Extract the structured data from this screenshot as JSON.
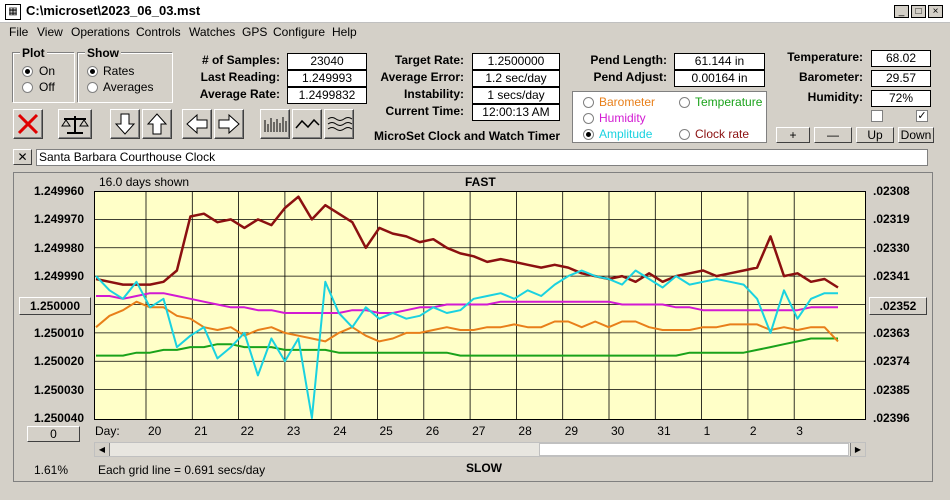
{
  "window": {
    "title": "C:\\microset\\2023_06_03.mst"
  },
  "menu": [
    "File",
    "View",
    "Operations",
    "Controls",
    "Watches",
    "GPS",
    "Configure",
    "Help"
  ],
  "plot_group": {
    "title": "Plot",
    "options": [
      "On",
      "Off"
    ],
    "selected": "On"
  },
  "show_group": {
    "title": "Show",
    "options": [
      "Rates",
      "Averages"
    ],
    "selected": "Rates"
  },
  "stats": {
    "samples_label": "# of Samples:",
    "samples": "23040",
    "last_label": "Last Reading:",
    "last": "1.249993",
    "avg_rate_label": "Average Rate:",
    "avg_rate": "1.2499832"
  },
  "rates": {
    "target_label": "Target Rate:",
    "target": "1.2500000",
    "error_label": "Average Error:",
    "error": "1.2 sec/day",
    "instab_label": "Instability:",
    "instab": "1 secs/day",
    "time_label": "Current Time:",
    "time": "12:00:13 AM"
  },
  "app_caption": "MicroSet Clock and Watch Timer",
  "pend": {
    "length_label": "Pend Length:",
    "length": "61.144 in",
    "adjust_label": "Pend Adjust:",
    "adjust": "0.00164 in"
  },
  "series_select": {
    "items": [
      {
        "label": "Barometer",
        "color": "#e87f1a",
        "selected": false
      },
      {
        "label": "Temperature",
        "color": "#1aa21a",
        "selected": false
      },
      {
        "label": "Humidity",
        "color": "#d21ad2",
        "selected": false
      },
      {
        "label": "Amplitude",
        "color": "#1ad2e0",
        "selected": true
      },
      {
        "label": "Clock rate",
        "color": "#8b1010",
        "selected": false
      }
    ]
  },
  "env": {
    "temp_label": "Temperature:",
    "temp": "68.02",
    "baro_label": "Barometer:",
    "baro": "29.57",
    "hum_label": "Humidity:",
    "hum": "72%"
  },
  "checks": [
    false,
    true
  ],
  "env_buttons": [
    "+",
    "—",
    "Up",
    "Down"
  ],
  "clock_name": "Santa Barbara Courthouse Clock",
  "chart_info": {
    "days_shown": "16.0 days shown",
    "fast": "FAST",
    "slow": "SLOW",
    "grid_note": "Each grid line = 0.691 secs/day",
    "percent": "1.61%",
    "left_button": "1.250000",
    "right_button": ".02352",
    "bottom_button": "0",
    "day_label": "Day:"
  },
  "chart_data": {
    "type": "line",
    "x_ticks": [
      "20",
      "21",
      "22",
      "23",
      "24",
      "25",
      "26",
      "27",
      "28",
      "29",
      "30",
      "31",
      "1",
      "2",
      "3"
    ],
    "y_left_ticks": [
      "1.249960",
      "1.249970",
      "1.249980",
      "1.249990",
      "1.250000",
      "1.250010",
      "1.250020",
      "1.250030",
      "1.250040"
    ],
    "y_left_range": [
      1.24996,
      1.25004
    ],
    "y_right_ticks": [
      ".02308",
      ".02319",
      ".02330",
      ".02341",
      ".02352",
      ".02363",
      ".02374",
      ".02385",
      ".02396"
    ],
    "series": [
      {
        "name": "Clock rate",
        "color": "#8b1010",
        "width": 2.5,
        "values": [
          1.249991,
          1.249992,
          1.249993,
          1.249993,
          1.249993,
          1.249992,
          1.249988,
          1.249969,
          1.249968,
          1.249971,
          1.24997,
          1.249973,
          1.24997,
          1.249972,
          1.249966,
          1.249962,
          1.24997,
          1.249965,
          1.249968,
          1.249971,
          1.24998,
          1.249973,
          1.249975,
          1.249976,
          1.249978,
          1.249977,
          1.24998,
          1.249982,
          1.249983,
          1.249985,
          1.249984,
          1.249985,
          1.249986,
          1.249987,
          1.249986,
          1.249987,
          1.249989,
          1.24999,
          1.249991,
          1.24999,
          1.249992,
          1.249989,
          1.249992,
          1.24999,
          1.249989,
          1.249988,
          1.24999,
          1.249989,
          1.249988,
          1.249987,
          1.249976,
          1.24999,
          1.249989,
          1.249992,
          1.249991,
          1.249994
        ]
      },
      {
        "name": "Amplitude",
        "color": "#1ad2e0",
        "width": 2,
        "values": [
          1.24999,
          1.249995,
          1.249998,
          1.249992,
          1.250001,
          1.249998,
          1.250015,
          1.250011,
          1.250008,
          1.250019,
          1.250015,
          1.25001,
          1.250025,
          1.250012,
          1.25002,
          1.250012,
          1.25004,
          1.249992,
          1.250003,
          1.250008,
          1.250001,
          1.250005,
          1.250003,
          1.250005,
          1.250004,
          1.250001,
          1.250003,
          1.250002,
          1.249998,
          1.249997,
          1.249996,
          1.249998,
          1.249995,
          1.249997,
          1.249993,
          1.24999,
          1.249988,
          1.24999,
          1.249991,
          1.249993,
          1.249988,
          1.249991,
          1.249994,
          1.24999,
          1.249993,
          1.249992,
          1.249991,
          1.249992,
          1.249993,
          1.249998,
          1.25001,
          1.249995,
          1.250005,
          1.249998,
          1.249996,
          1.249996
        ]
      },
      {
        "name": "Humidity",
        "color": "#d21ad2",
        "width": 2,
        "values": [
          1.249997,
          1.249997,
          1.249998,
          1.249997,
          1.249996,
          1.249996,
          1.249997,
          1.249998,
          1.249999,
          1.25,
          1.250001,
          1.250001,
          1.250002,
          1.250002,
          1.250003,
          1.250003,
          1.250003,
          1.250003,
          1.250003,
          1.250002,
          1.250002,
          1.250003,
          1.250003,
          1.250002,
          1.250001,
          1.250001,
          1.25,
          1.25,
          1.25,
          1.25,
          1.249999,
          1.249999,
          1.249999,
          1.249999,
          1.249999,
          1.249999,
          1.249999,
          1.249999,
          1.249999,
          1.25,
          1.25,
          1.25,
          1.25,
          1.250001,
          1.250001,
          1.250002,
          1.250002,
          1.250002,
          1.250002,
          1.250002,
          1.250002,
          1.250002,
          1.250002,
          1.250001,
          1.250001,
          1.250001
        ]
      },
      {
        "name": "Barometer",
        "color": "#e87f1a",
        "width": 2,
        "values": [
          1.250008,
          1.250004,
          1.250002,
          1.249999,
          1.250001,
          1.250001,
          1.250004,
          1.250005,
          1.250008,
          1.250009,
          1.250008,
          1.250011,
          1.250009,
          1.250008,
          1.25001,
          1.250011,
          1.250012,
          1.250013,
          1.25001,
          1.250008,
          1.250011,
          1.250013,
          1.250012,
          1.25001,
          1.25001,
          1.250009,
          1.250008,
          1.250009,
          1.250009,
          1.250008,
          1.250008,
          1.250007,
          1.250008,
          1.250008,
          1.250006,
          1.250006,
          1.250008,
          1.250006,
          1.250008,
          1.250006,
          1.250006,
          1.250008,
          1.250009,
          1.250009,
          1.250009,
          1.250008,
          1.250008,
          1.250007,
          1.250007,
          1.250007,
          1.250009,
          1.250008,
          1.250009,
          1.250008,
          1.250008,
          1.250013
        ]
      },
      {
        "name": "Temperature",
        "color": "#1aa21a",
        "width": 2,
        "values": [
          1.250018,
          1.250018,
          1.250018,
          1.250017,
          1.250017,
          1.250016,
          1.250016,
          1.250015,
          1.250015,
          1.250014,
          1.250014,
          1.250015,
          1.250015,
          1.250015,
          1.250016,
          1.250016,
          1.250016,
          1.250016,
          1.250017,
          1.250017,
          1.250017,
          1.250017,
          1.250017,
          1.250017,
          1.250017,
          1.250017,
          1.250017,
          1.250018,
          1.250018,
          1.250018,
          1.250018,
          1.250018,
          1.250018,
          1.250018,
          1.250018,
          1.250018,
          1.250018,
          1.250018,
          1.250018,
          1.250018,
          1.250018,
          1.250018,
          1.250018,
          1.250018,
          1.250017,
          1.250017,
          1.250017,
          1.250017,
          1.250017,
          1.250016,
          1.250015,
          1.250014,
          1.250013,
          1.250012,
          1.250012,
          1.250012
        ]
      }
    ]
  }
}
